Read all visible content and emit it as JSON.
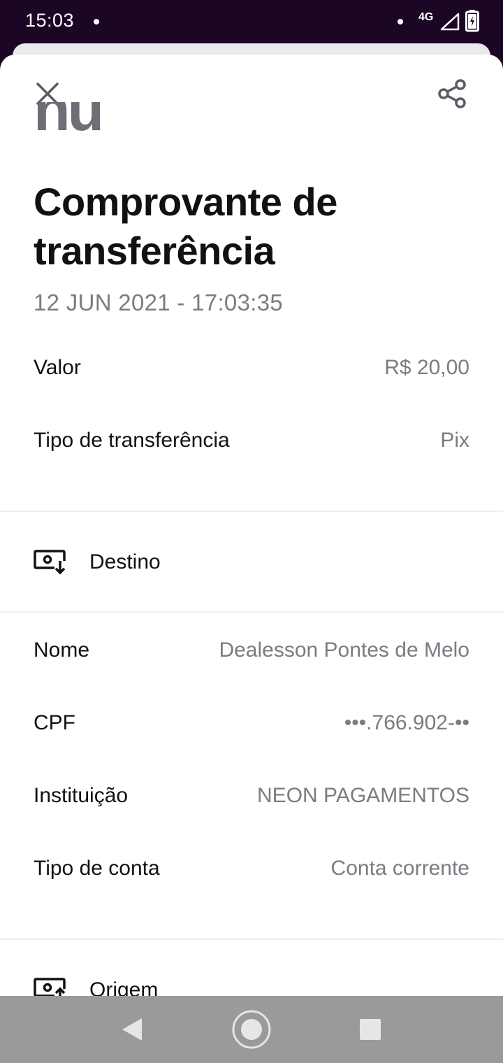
{
  "status_bar": {
    "time": "15:03",
    "network": "4G"
  },
  "header": {
    "close_icon": "close-icon",
    "share_icon": "share-icon",
    "logo_text": "nu"
  },
  "receipt": {
    "title": "Comprovante de transferência",
    "datetime": "12 JUN 2021 - 17:03:35",
    "summary": [
      {
        "label": "Valor",
        "value": "R$ 20,00"
      },
      {
        "label": "Tipo de transferência",
        "value": "Pix"
      }
    ],
    "destination": {
      "heading": "Destino",
      "icon": "receive-money-icon",
      "fields": [
        {
          "label": "Nome",
          "value": "Dealesson Pontes de Melo"
        },
        {
          "label": "CPF",
          "value": "•••.766.902-••"
        },
        {
          "label": "Instituição",
          "value": "NEON PAGAMENTOS"
        },
        {
          "label": "Tipo de conta",
          "value": "Conta corrente"
        }
      ]
    },
    "origin": {
      "heading": "Origem",
      "icon": "send-money-icon"
    }
  },
  "nav_bar": {
    "back_icon": "back-triangle-icon",
    "home_icon": "home-circle-icon",
    "recent_icon": "recent-square-icon"
  },
  "colors": {
    "status_bar_bg": "#1c0626",
    "label": "#111111",
    "value": "#7c7b83",
    "logo": "#6f6e77",
    "nav_bar_bg": "#9a9a9a"
  }
}
